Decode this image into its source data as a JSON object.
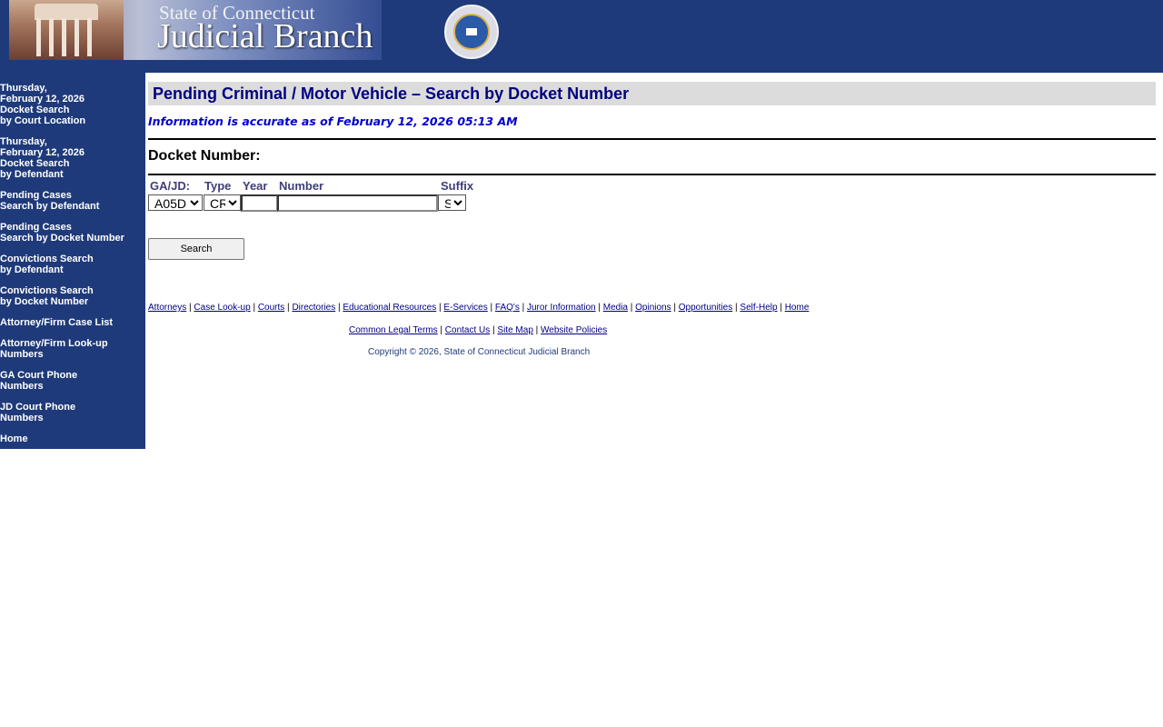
{
  "header": {
    "banner_line1": "State of Connecticut",
    "banner_line2": "Judicial Branch"
  },
  "sidebar": {
    "items": [
      {
        "label": "Thursday,\nFebruary 12, 2026\nDocket Search\nby Court Location"
      },
      {
        "label": "Thursday,\nFebruary 12, 2026\nDocket Search\nby Defendant"
      },
      {
        "label": "Pending Cases\nSearch by Defendant"
      },
      {
        "label": "Pending Cases\nSearch by Docket Number"
      },
      {
        "label": "Convictions Search\nby Defendant"
      },
      {
        "label": "Convictions Search\nby Docket Number"
      },
      {
        "label": "Attorney/Firm Case List"
      },
      {
        "label": "Attorney/Firm Look-up\nNumbers"
      },
      {
        "label": "GA Court Phone\nNumbers"
      },
      {
        "label": "JD Court Phone\nNumbers"
      },
      {
        "label": "Home"
      }
    ]
  },
  "main": {
    "title": "Pending Criminal / Motor Vehicle – Search by Docket Number",
    "accuracy": "Information is accurate as of February 12, 2026 05:13 AM",
    "docket_label": "Docket Number:",
    "form": {
      "gajd_label": "GA/JD:",
      "type_label": "Type",
      "year_label": "Year",
      "number_label": "Number",
      "suffix_label": "Suffix",
      "gajd_value": "A05D",
      "type_value": "CR",
      "year_value": "",
      "number_value": "",
      "suffix_value": "S",
      "search_label": "Search"
    }
  },
  "footer": {
    "links1": [
      "Attorneys",
      "Case Look-up",
      "Courts",
      "Directories",
      "Educational Resources",
      "E-Services",
      "FAQ's",
      "Juror Information",
      "Media",
      "Opinions",
      "Opportunities",
      "Self-Help",
      "Home"
    ],
    "links2": [
      "Common Legal Terms",
      "Contact Us",
      "Site Map",
      "Website Policies"
    ],
    "separator": "|",
    "copyright": "Copyright © 2026, State of Connecticut Judicial Branch"
  },
  "colors": {
    "brand_navy": "#1f3a7a",
    "title_text": "#000080",
    "accuracy_text": "#0000cc",
    "title_bar": "#dcdcdc"
  }
}
